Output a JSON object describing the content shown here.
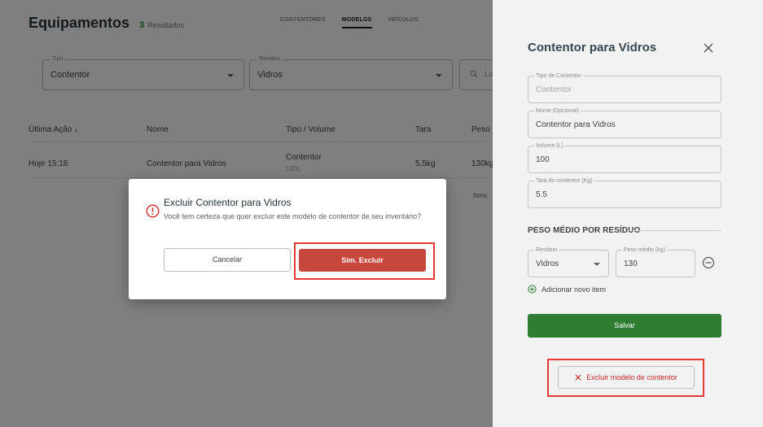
{
  "page": {
    "title": "Equipamentos",
    "result_count": "3",
    "result_label": "Resultados",
    "tabs": [
      {
        "label": "CONTENTORES",
        "active": false
      },
      {
        "label": "MODELOS",
        "active": true
      },
      {
        "label": "VEÍCULOS",
        "active": false
      }
    ]
  },
  "filters": {
    "tipo": {
      "label": "Tipo",
      "value": "Contentor"
    },
    "residuo": {
      "label": "Resíduo",
      "value": "Vidros"
    },
    "search": {
      "placeholder": "Lo"
    }
  },
  "table": {
    "headers": [
      "Última Ação ↓",
      "Nome",
      "Tipo / Volume",
      "Tara",
      "Peso M"
    ],
    "rows": [
      {
        "last_action": "Hoje 15:18",
        "name": "Contentor para Vidros",
        "type": "Contentor",
        "volume": "100L",
        "tara": "5,5kg",
        "peso": "130kg"
      }
    ],
    "items_label": "Itens"
  },
  "drawer": {
    "title": "Contentor para Vidros",
    "fields": {
      "tipo": {
        "label": "Tipo de Contentor",
        "value": "Contentor"
      },
      "nome": {
        "label": "Nome (Opcional)",
        "value": "Contentor para Vidros"
      },
      "volume": {
        "label": "Volume (L)",
        "value": "100"
      },
      "tara": {
        "label": "Tara do contentor (Kg)",
        "value": "5.5"
      }
    },
    "section_title": "PESO MÉDIO POR RESÍDUO",
    "residue_item": {
      "residuo_label": "Resíduo",
      "residuo_value": "Vidros",
      "peso_label": "Peso médio (kg)",
      "peso_value": "130"
    },
    "add_item_label": "Adicionar novo item",
    "save_label": "Salvar",
    "delete_label": "Excluir modelo de contentor"
  },
  "modal": {
    "title": "Excluir Contentor para Vidros",
    "message": "Você tem certeza que quer excluir este modelo de contentor de seu inventário?",
    "cancel_label": "Cancelar",
    "confirm_label": "Sim. Excluir"
  },
  "colors": {
    "primary_green": "#2e7d32",
    "danger_red": "#c8473c",
    "highlight_red": "#e53935"
  }
}
